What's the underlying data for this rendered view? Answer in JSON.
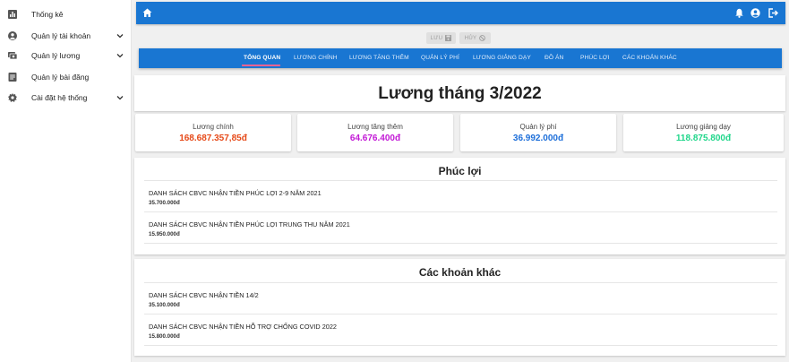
{
  "sidebar": {
    "items": [
      {
        "label": "Thống kê",
        "icon": "bar-chart-icon"
      },
      {
        "label": "Quản lý tài khoản",
        "icon": "account-circle-icon",
        "expandable": true
      },
      {
        "label": "Quản lý lương",
        "icon": "payments-icon",
        "expandable": true
      },
      {
        "label": "Quản lý bài đăng",
        "icon": "article-icon"
      },
      {
        "label": "Cài đặt hệ thống",
        "icon": "gear-icon",
        "expandable": true
      }
    ]
  },
  "topbar": {
    "icons": [
      "home-icon",
      "bell-icon",
      "account-icon",
      "logout-icon"
    ],
    "color": "#1976d2"
  },
  "actions": {
    "save_label": "LƯU",
    "cancel_label": "HỦY"
  },
  "tabs": [
    {
      "label": "TỔNG QUAN",
      "active": true
    },
    {
      "label": "LƯƠNG CHÍNH"
    },
    {
      "label": "LƯƠNG TĂNG THÊM"
    },
    {
      "label": "QUẢN LÝ PHÍ"
    },
    {
      "label": "LƯƠNG GIẢNG DẠY"
    },
    {
      "label": "ĐỒ ÁN"
    },
    {
      "label": "PHÚC LỢI"
    },
    {
      "label": "CÁC KHOẢN KHÁC"
    }
  ],
  "page_title": "Lương tháng 3/2022",
  "summary_cards": [
    {
      "label": "Lương chính",
      "value": "168.687.357,85đ",
      "color": "#e64a19"
    },
    {
      "label": "Lương tăng thêm",
      "value": "64.676.400đ",
      "color": "#c218d6"
    },
    {
      "label": "Quản lý phí",
      "value": "36.992.000đ",
      "color": "#1e6fd9"
    },
    {
      "label": "Lương giảng dạy",
      "value": "118.875.800đ",
      "color": "#1fd68a"
    }
  ],
  "benefits": {
    "title": "Phúc lợi",
    "items": [
      {
        "title": "DANH SÁCH CBVC NHẬN TIỀN PHÚC LỢI 2-9 NĂM 2021",
        "amount": "35.700.000đ"
      },
      {
        "title": "DANH SÁCH CBVC NHẬN TIỀN PHÚC LỢI TRUNG THU NĂM 2021",
        "amount": "15.950.000đ"
      }
    ]
  },
  "others": {
    "title": "Các khoản khác",
    "items": [
      {
        "title": "DANH SÁCH CBVC NHẬN TIỀN 14/2",
        "amount": "35.100.000đ"
      },
      {
        "title": "DANH SÁCH CBVC NHẬN TIỀN HỖ TRỢ CHỐNG COVID 2022",
        "amount": "15.800.000đ"
      }
    ]
  }
}
